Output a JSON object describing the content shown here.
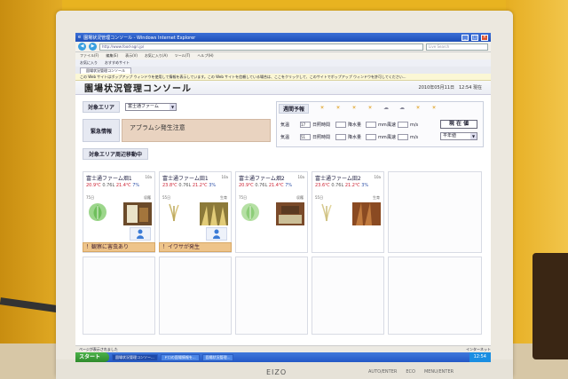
{
  "browser": {
    "window_title": "園場状況管理コンソール - Windows Internet Explorer",
    "url": "http://www.food-agri.jp/",
    "search_placeholder": "Live Search",
    "menus": [
      "ファイル(F)",
      "編集(E)",
      "表示(V)",
      "お気に入り(A)",
      "ツール(T)",
      "ヘルプ(H)"
    ],
    "favorites": [
      "お気に入り",
      "おすすめサイト"
    ],
    "tab_label": "園場状況管理コンソール",
    "infobar_text": "この Web サイトはポップアップ ウィンドウを使用して情報を表示しています。この Web サイトを信頼している場合は、ここをクリックして、このサイトでポップアップ ウィンドウを許可してください...",
    "status_text": "ページが表示されました",
    "zone_text": "インターネット"
  },
  "page": {
    "title": "園場状況管理コンソール",
    "datetime": "2010年05月11日　12:54 現在"
  },
  "controls": {
    "area_label": "対象エリア",
    "area_value": "富士通ファーム",
    "alert_label": "緊急情報",
    "alert_text": "アブラムシ発生注意",
    "move_label": "対象エリア周辺移動中",
    "forecast_label": "週間予報",
    "row1_label": "気温",
    "row1_value": "17",
    "row1_sun": "日照時間",
    "row1_rain": "降水量",
    "row1_rain_unit": "mm",
    "row1_wind": "風速",
    "row1_wind_unit": "m/s",
    "row2_label": "気温",
    "row2_value": "51",
    "row2_sun": "日照時間",
    "row2_rain": "降水量",
    "row2_rain_unit": "mm",
    "row2_wind": "風速",
    "row2_wind_unit": "m/s",
    "now_button": "現 在 値",
    "period_select": "平年値"
  },
  "cards": [
    {
      "name": "富士通ファーム畑1",
      "area": "10a",
      "temp": "20.9℃",
      "rain": "0.76L",
      "soil": "21.4℃",
      "humidity": "7%",
      "days": "75日",
      "stage": "収穫",
      "warning": "！観察に害虫あり"
    },
    {
      "name": "富士通ファーム田1",
      "area": "10a",
      "temp": "23.8℃",
      "rain": "0.76L",
      "soil": "21.2℃",
      "humidity": "3%",
      "days": "55日",
      "stage": "生育",
      "warning": "！イワサが発生"
    },
    {
      "name": "富士通ファーム畑2",
      "area": "10a",
      "temp": "20.9℃",
      "rain": "0.76L",
      "soil": "21.4℃",
      "humidity": "7%",
      "days": "75日",
      "stage": "収穫",
      "warning": ""
    },
    {
      "name": "富士通ファーム田2",
      "area": "10a",
      "temp": "23.6℃",
      "rain": "0.76L",
      "soil": "21.2℃",
      "humidity": "3%",
      "days": "55日",
      "stage": "生育",
      "warning": ""
    }
  ],
  "taskbar": {
    "start": "スタート",
    "items": [
      "園場状況管理コンソー...",
      "ドロの園場情報を...",
      "園場状況管理..."
    ],
    "clock": "12:54"
  },
  "monitor": {
    "brand": "EIZO",
    "buttons": [
      "AUTO/ENTER",
      "ECO",
      "MENU/ENTER"
    ]
  },
  "colors": {
    "accent": "#1e4fb8",
    "alert_bg": "#e9d3c0",
    "warning_bg": "#eec48a"
  }
}
